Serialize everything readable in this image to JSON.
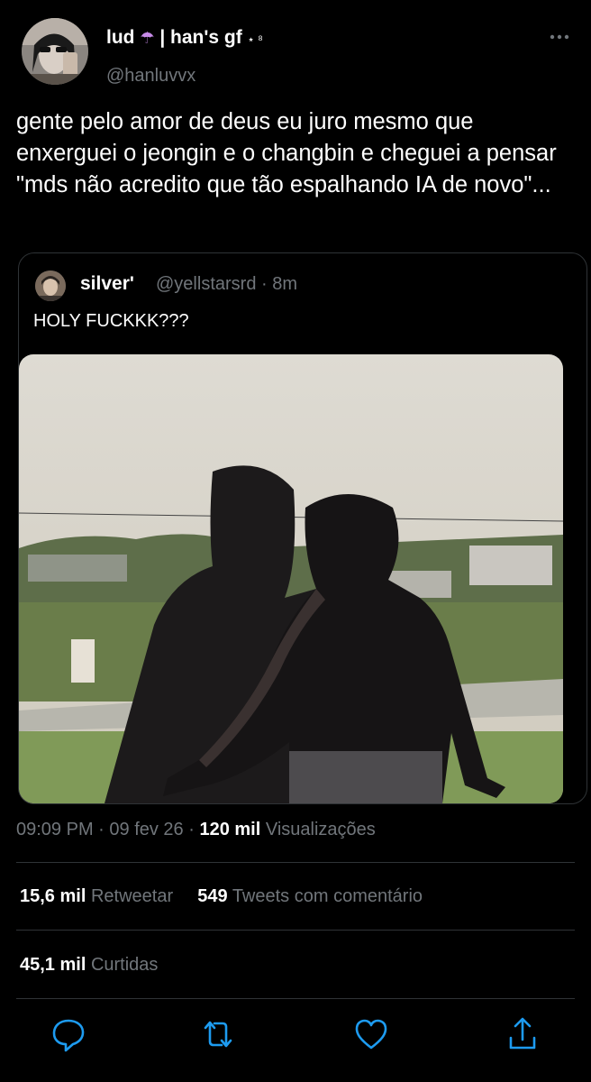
{
  "author": {
    "display_name": "lud",
    "umbrella_glyph": "☂",
    "name_rest": "| han's gf",
    "name_star": "⋆ ⁸",
    "handle": "@hanluvvx"
  },
  "tweet": {
    "text": "gente pelo amor de deus eu juro mesmo que enxerguei o jeongin e o changbin e cheguei a pensar \"mds não acredito que tão espalhando IA de novo\"...",
    "time": "09:09 PM",
    "date": "09 fev 26",
    "views_count": "120 mil",
    "views_label": "Visualizações"
  },
  "quoted": {
    "display_name": "silver'",
    "handle": "@yellstarsrd",
    "time_ago": "8m",
    "text": "HOLY FUCKKK???"
  },
  "stats": {
    "retweets_count": "15,6 mil",
    "retweets_label": "Retweetar",
    "quotes_count": "549",
    "quotes_label": "Tweets com comentário",
    "likes_count": "45,1 mil",
    "likes_label": "Curtidas"
  },
  "icons": {
    "more": "more-icon",
    "reply": "reply-icon",
    "retweet": "retweet-icon",
    "like": "heart-icon",
    "share": "share-icon"
  },
  "colors": {
    "background": "#000000",
    "text": "#ffffff",
    "secondary_text": "#71767b",
    "divider": "#2f3336",
    "icon_accent": "#1d9bf0"
  }
}
